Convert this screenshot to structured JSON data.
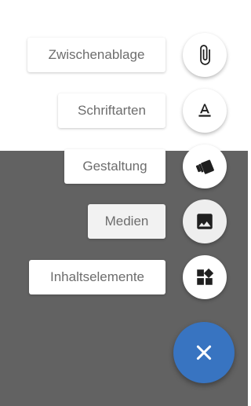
{
  "speed_dial": {
    "actions": [
      {
        "label": "Zwischenablage",
        "icon": "paperclip-icon"
      },
      {
        "label": "Schriftarten",
        "icon": "text-format-icon"
      },
      {
        "label": "Gestaltung",
        "icon": "style-cards-icon"
      },
      {
        "label": "Medien",
        "icon": "image-icon",
        "active": true
      },
      {
        "label": "Inhaltselemente",
        "icon": "widgets-icon"
      }
    ],
    "close_icon": "close-icon"
  },
  "colors": {
    "overlay": "#626262",
    "fab_main": "#3874c1",
    "label_text": "#6d6d6d"
  }
}
